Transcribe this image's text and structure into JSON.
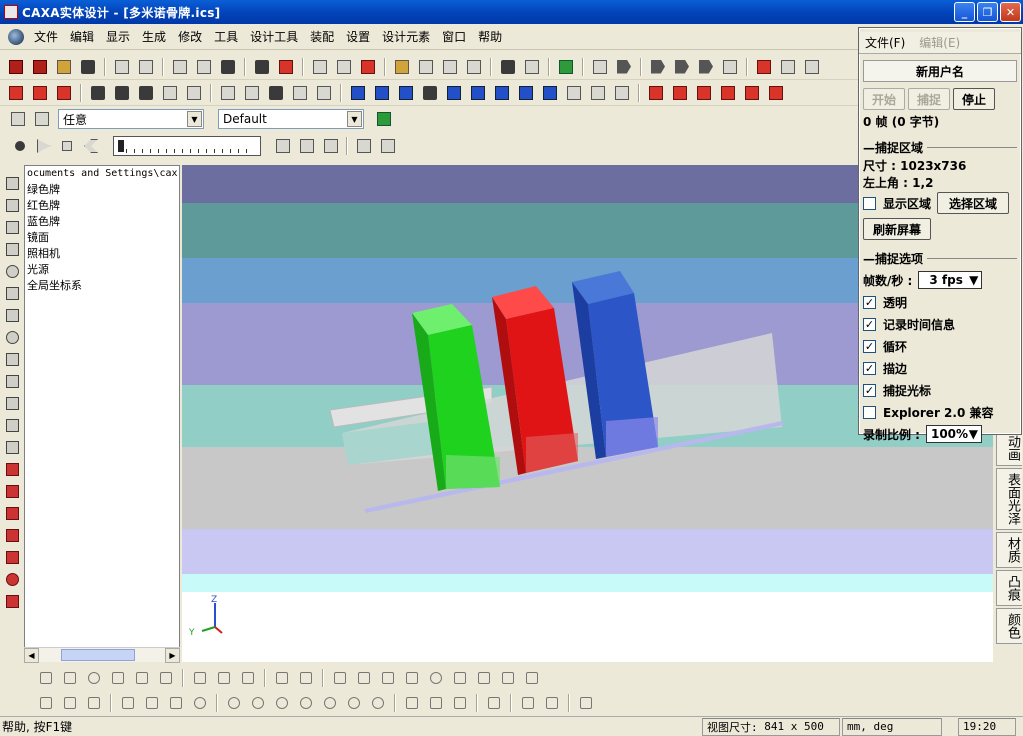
{
  "window": {
    "title": "CAXA实体设计 - [多米诺骨牌.ics]",
    "minimize": "_",
    "restore": "❐",
    "close": "✕"
  },
  "menu": [
    "文件",
    "编辑",
    "显示",
    "生成",
    "修改",
    "工具",
    "设计工具",
    "装配",
    "设置",
    "设计元素",
    "窗口",
    "帮助"
  ],
  "toolbar": {
    "selector_value": "任意",
    "style_value": "Default"
  },
  "tree": {
    "path": "ocuments and Settings\\cax",
    "items": [
      "绿色牌",
      "红色牌",
      "蓝色牌",
      "镜面",
      "照相机",
      "光源",
      "全局坐标系"
    ]
  },
  "sidetabs": [
    "动画",
    "表面光泽",
    "材质",
    "凸痕",
    "颜色"
  ],
  "status": {
    "hint": "帮助, 按F1键",
    "view_size_label": "视图尺寸:",
    "view_size": "841 x  500",
    "units": "mm, deg",
    "time": "19:20"
  },
  "axes": {
    "z": "Z",
    "y": "Y"
  },
  "capture": {
    "menu_file": "文件(F)",
    "menu_edit": "编辑(E)",
    "user": "新用户名",
    "start": "开始",
    "capture": "捕捉",
    "stop": "停止",
    "frames": "0 帧 (0 字节)",
    "region_title": "捕捉区域",
    "size": "尺寸 : 1023x736",
    "topleft": "左上角 : 1,2",
    "show_region": "显示区域",
    "select_region": "选择区域",
    "refresh": "刷新屏幕",
    "options_title": "捕捉选项",
    "fps_label": "帧数/秒 :",
    "fps_value": "3 fps",
    "opt_transparent": "透明",
    "opt_timeinfo": "记录时间信息",
    "opt_loop": "循环",
    "opt_border": "描边",
    "opt_cursor": "捕捉光标",
    "opt_explorer": "Explorer 2.0 兼容",
    "scale_label": "录制比例 :",
    "scale_value": "100%"
  },
  "colors": {
    "green": "#1ed21e",
    "red": "#e01414",
    "blue": "#2c55c8",
    "band1": "#6b6e9e",
    "band2": "#5e9a9a",
    "band3": "#6a9fd0",
    "band4": "#9c9ad0",
    "band5": "#90cec6",
    "band6": "#c8c8c8",
    "band7": "#c8c8f2",
    "band8": "#c8fafa"
  }
}
